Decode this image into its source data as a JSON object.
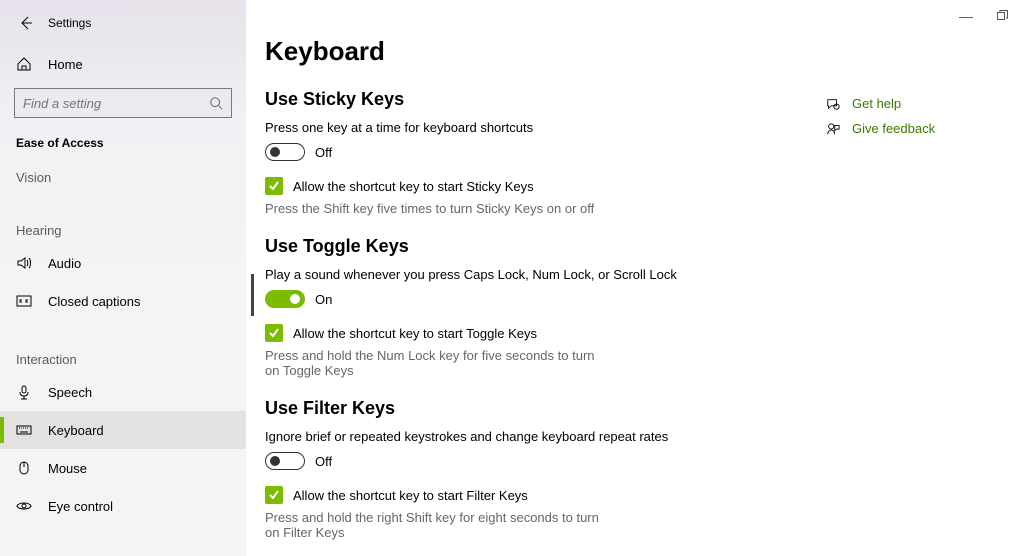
{
  "app": {
    "title": "Settings"
  },
  "sidebar": {
    "home": "Home",
    "search_placeholder": "Find a setting",
    "section": "Ease of Access",
    "group1": "Vision",
    "group2": "Hearing",
    "group3": "Interaction",
    "items_hearing": [
      {
        "label": "Audio"
      },
      {
        "label": "Closed captions"
      }
    ],
    "items_interaction": [
      {
        "label": "Speech"
      },
      {
        "label": "Keyboard"
      },
      {
        "label": "Mouse"
      },
      {
        "label": "Eye control"
      }
    ]
  },
  "page": {
    "title": "Keyboard",
    "sticky": {
      "heading": "Use Sticky Keys",
      "desc": "Press one key at a time for keyboard shortcuts",
      "toggle_state": "Off",
      "check_label": "Allow the shortcut key to start Sticky Keys",
      "hint": "Press the Shift key five times to turn Sticky Keys on or off"
    },
    "toggle": {
      "heading": "Use Toggle Keys",
      "desc": "Play a sound whenever you press Caps Lock, Num Lock, or Scroll Lock",
      "toggle_state": "On",
      "check_label": "Allow the shortcut key to start Toggle Keys",
      "hint": "Press and hold the Num Lock key for five seconds to turn on Toggle Keys"
    },
    "filter": {
      "heading": "Use Filter Keys",
      "desc": "Ignore brief or repeated keystrokes and change keyboard repeat rates",
      "toggle_state": "Off",
      "check_label": "Allow the shortcut key to start Filter Keys",
      "hint": "Press and hold the right Shift key for eight seconds to turn on Filter Keys"
    }
  },
  "right": {
    "help": "Get help",
    "feedback": "Give feedback"
  }
}
